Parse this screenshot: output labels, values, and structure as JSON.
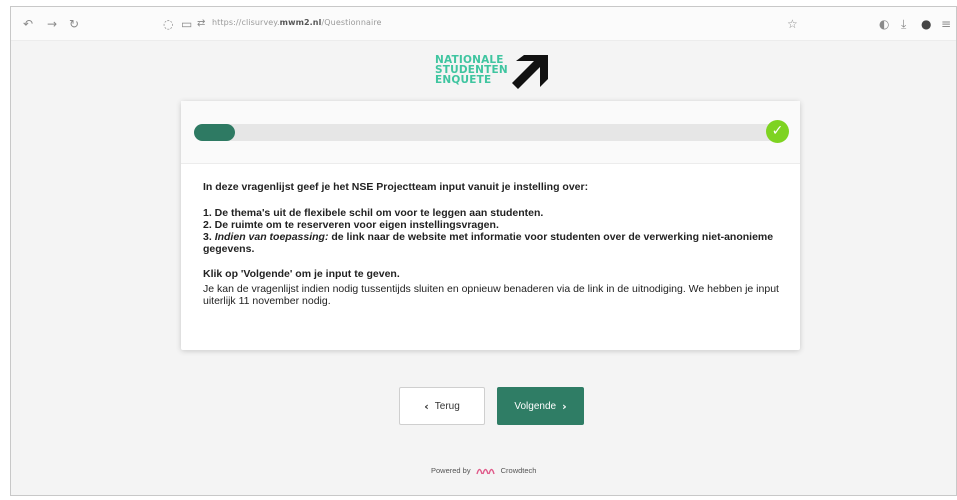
{
  "browser": {
    "url_prefix": "https://clisurvey.",
    "url_domain": "mwm2.nl",
    "url_path": "/Questionnaire",
    "icons": [
      "back-icon",
      "forward-icon",
      "reload-icon",
      "shield-icon",
      "page-icon",
      "permissions-icon",
      "bookmark-star-icon",
      "pocket-icon",
      "download-icon",
      "extension-icon",
      "menu-icon"
    ]
  },
  "logo": {
    "line1": "NATIONALE",
    "line2": "STUDENTEN",
    "line3": "ENQUETE",
    "color": "#3fc5a0"
  },
  "progress": {
    "value": 0.07,
    "fill_color": "#2e7a63",
    "check_color": "#7ed321",
    "check_glyph": "✓"
  },
  "content": {
    "intro": "In deze vragenlijst geef je het NSE Projectteam input vanuit je instelling over:",
    "item1": "1. De thema's uit de flexibele schil om voor te leggen aan studenten.",
    "item2": "2. De ruimte om te reserveren voor eigen instellingsvragen.",
    "item3_prefix": "3. ",
    "item3_italic": "Indien van toepassing:",
    "item3_rest": " de link naar de website met informatie voor studenten over de verwerking niet-anonieme gegevens.",
    "cta": "Klik op 'Volgende' om je input te geven.",
    "note": "Je kan de vragenlijst indien nodig tussentijds sluiten en opnieuw benaderen via de link in de uitnodiging. We hebben je input uiterlijk 11 november nodig."
  },
  "buttons": {
    "back_label": "Terug",
    "back_chevron": "‹",
    "next_label": "Volgende",
    "next_chevron": "›",
    "next_color": "#2f7d65"
  },
  "footer": {
    "powered_by": "Powered by",
    "brand": "Crowdtech",
    "logo_color": "#e05a8a"
  }
}
